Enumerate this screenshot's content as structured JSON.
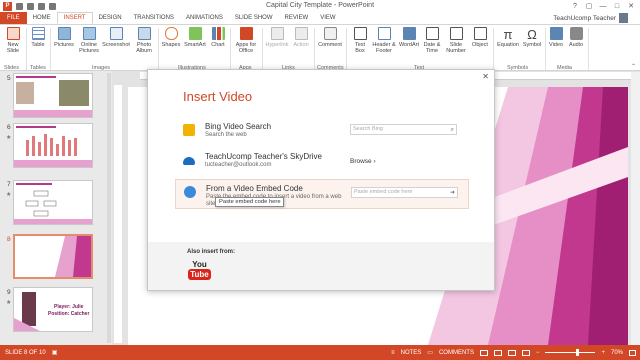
{
  "window": {
    "title": "Capital City Template - PowerPoint",
    "app_icon": "P",
    "controls": [
      "?",
      "▢",
      "—",
      "□",
      "✕"
    ]
  },
  "tabs": [
    "FILE",
    "HOME",
    "INSERT",
    "DESIGN",
    "TRANSITIONS",
    "ANIMATIONS",
    "SLIDE SHOW",
    "REVIEW",
    "VIEW"
  ],
  "active_tab": "INSERT",
  "user": "TeachUcomp Teacher",
  "ribbon": {
    "buttons": {
      "new_slide": "New Slide",
      "table": "Table",
      "pictures": "Pictures",
      "online_pictures": "Online Pictures",
      "screenshot": "Screenshot",
      "photo_album": "Photo Album",
      "shapes": "Shapes",
      "smartart": "SmartArt",
      "chart": "Chart",
      "apps": "Apps for Office",
      "hyperlink": "Hyperlink",
      "action": "Action",
      "comment": "Comment",
      "text_box": "Text Box",
      "header_footer": "Header & Footer",
      "wordart": "WordArt",
      "date_time": "Date & Time",
      "slide_number": "Slide Number",
      "object": "Object",
      "equation": "Equation",
      "symbol": "Symbol",
      "video": "Video",
      "audio": "Audio"
    },
    "groups": {
      "slides": "Slides",
      "tables": "Tables",
      "images": "Images",
      "illustrations": "Illustrations",
      "apps": "Apps",
      "links": "Links",
      "comments": "Comments",
      "text": "Text",
      "symbols": "Symbols",
      "media": "Media"
    },
    "colors": {
      "accent": "#d24726"
    }
  },
  "thumbnails": {
    "numbers": [
      "5",
      "6",
      "7",
      "8",
      "9"
    ],
    "slide9": {
      "player": "Player: Julie",
      "position": "Position: Catcher"
    }
  },
  "dialog": {
    "title": "Insert Video",
    "close": "✕",
    "options": [
      {
        "title": "Bing Video Search",
        "subtitle": "Search the web",
        "placeholder": "Search Bing",
        "icon": "bing-icon"
      },
      {
        "title": "TeachUcomp Teacher's SkyDrive",
        "subtitle": "tucteacher@outlook.com",
        "action": "Browse ›",
        "icon": "skydrive-cloud-icon"
      },
      {
        "title": "From a Video Embed Code",
        "subtitle": "Paste the embed code to insert a video from a web site",
        "placeholder": "Paste embed code here",
        "icon": "globe-icon"
      }
    ],
    "tooltip": "Paste embed code here",
    "also_insert": "Also insert from:",
    "youtube": {
      "you": "You",
      "tube": "Tube"
    }
  },
  "status": {
    "slide": "SLIDE 8 OF 10",
    "notes": "NOTES",
    "comments": "COMMENTS",
    "zoom": "70%",
    "zoom_level": 0.7
  }
}
